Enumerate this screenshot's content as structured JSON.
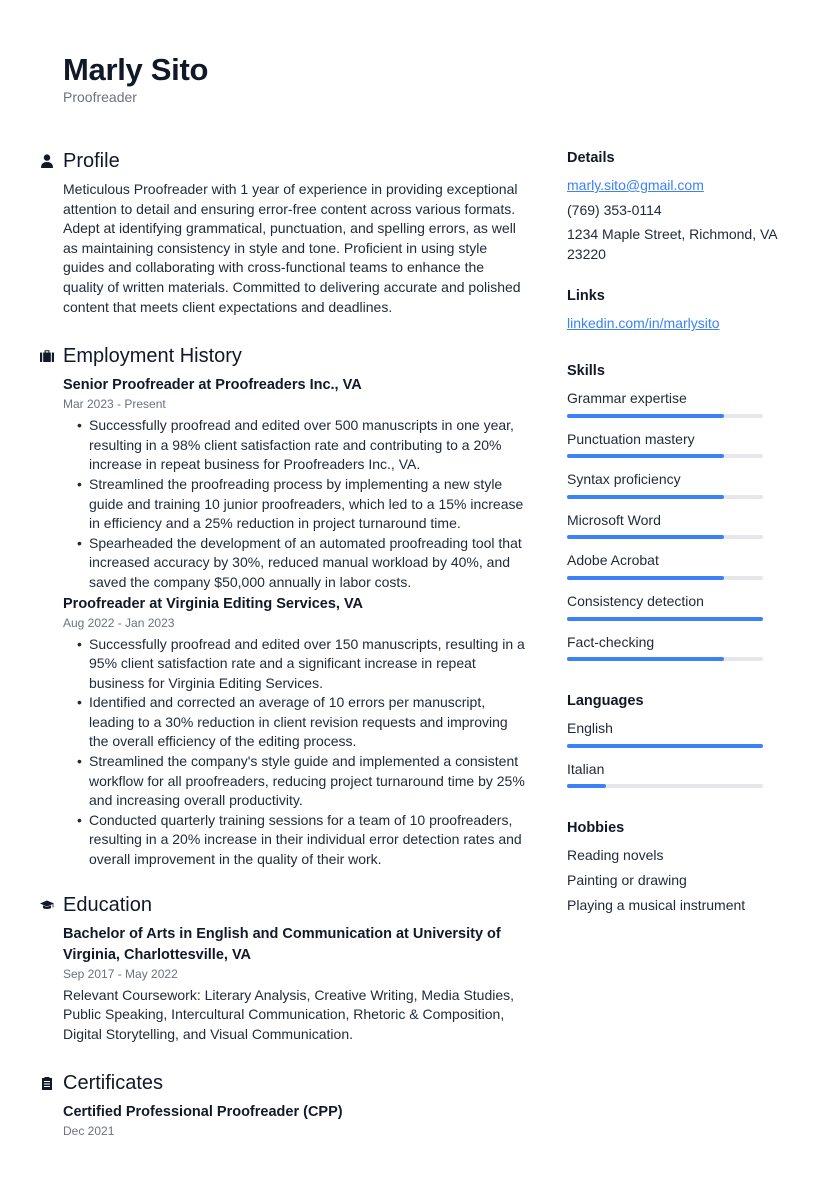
{
  "header": {
    "name": "Marly Sito",
    "title": "Proofreader"
  },
  "profile": {
    "heading": "Profile",
    "icon": "user-icon",
    "text": "Meticulous Proofreader with 1 year of experience in providing exceptional attention to detail and ensuring error-free content across various formats. Adept at identifying grammatical, punctuation, and spelling errors, as well as maintaining consistency in style and tone. Proficient in using style guides and collaborating with cross-functional teams to enhance the quality of written materials. Committed to delivering accurate and polished content that meets client expectations and deadlines."
  },
  "employment": {
    "heading": "Employment History",
    "icon": "briefcase-icon",
    "jobs": [
      {
        "title": "Senior Proofreader at Proofreaders Inc., VA",
        "dates": "Mar 2023 - Present",
        "bullets": [
          "Successfully proofread and edited over 500 manuscripts in one year, resulting in a 98% client satisfaction rate and contributing to a 20% increase in repeat business for Proofreaders Inc., VA.",
          "Streamlined the proofreading process by implementing a new style guide and training 10 junior proofreaders, which led to a 15% increase in efficiency and a 25% reduction in project turnaround time.",
          "Spearheaded the development of an automated proofreading tool that increased accuracy by 30%, reduced manual workload by 40%, and saved the company $50,000 annually in labor costs."
        ]
      },
      {
        "title": "Proofreader at Virginia Editing Services, VA",
        "dates": "Aug 2022 - Jan 2023",
        "bullets": [
          "Successfully proofread and edited over 150 manuscripts, resulting in a 95% client satisfaction rate and a significant increase in repeat business for Virginia Editing Services.",
          "Identified and corrected an average of 10 errors per manuscript, leading to a 30% reduction in client revision requests and improving the overall efficiency of the editing process.",
          "Streamlined the company's style guide and implemented a consistent workflow for all proofreaders, reducing project turnaround time by 25% and increasing overall productivity.",
          "Conducted quarterly training sessions for a team of 10 proofreaders, resulting in a 20% increase in their individual error detection rates and overall improvement in the quality of their work."
        ]
      }
    ]
  },
  "education": {
    "heading": "Education",
    "icon": "graduation-cap-icon",
    "entries": [
      {
        "title": "Bachelor of Arts in English and Communication at University of Virginia, Charlottesville, VA",
        "dates": "Sep 2017 - May 2022",
        "description": "Relevant Coursework: Literary Analysis, Creative Writing, Media Studies, Public Speaking, Intercultural Communication, Rhetoric & Composition, Digital Storytelling, and Visual Communication."
      }
    ]
  },
  "certificates": {
    "heading": "Certificates",
    "icon": "clipboard-icon",
    "entries": [
      {
        "title": "Certified Professional Proofreader (CPP)",
        "dates": "Dec 2021"
      }
    ]
  },
  "details": {
    "heading": "Details",
    "email": "marly.sito@gmail.com",
    "phone": "(769) 353-0114",
    "address": "1234 Maple Street, Richmond, VA 23220"
  },
  "links": {
    "heading": "Links",
    "items": [
      "linkedin.com/in/marlysito"
    ]
  },
  "skills": {
    "heading": "Skills",
    "items": [
      {
        "name": "Grammar expertise",
        "level": 0.8
      },
      {
        "name": "Punctuation mastery",
        "level": 0.8
      },
      {
        "name": "Syntax proficiency",
        "level": 0.8
      },
      {
        "name": "Microsoft Word",
        "level": 0.8
      },
      {
        "name": "Adobe Acrobat",
        "level": 0.8
      },
      {
        "name": "Consistency detection",
        "level": 1.0
      },
      {
        "name": "Fact-checking",
        "level": 0.8
      }
    ]
  },
  "languages": {
    "heading": "Languages",
    "items": [
      {
        "name": "English",
        "level": 1.0
      },
      {
        "name": "Italian",
        "level": 0.2
      }
    ]
  },
  "hobbies": {
    "heading": "Hobbies",
    "items": [
      "Reading novels",
      "Painting or drawing",
      "Playing a musical instrument"
    ]
  },
  "colors": {
    "accent": "#3b82f6",
    "track": "#e5e7eb",
    "text": "#1f2937",
    "muted": "#6b7280"
  }
}
